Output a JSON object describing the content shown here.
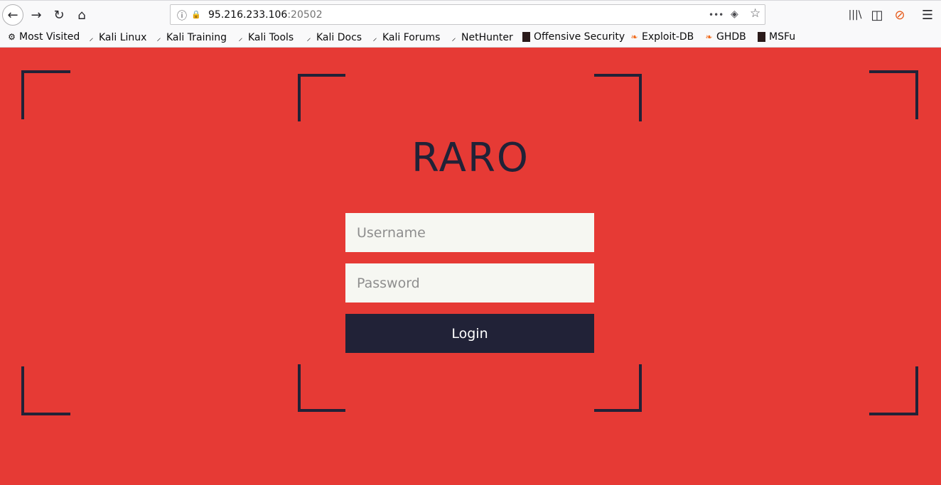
{
  "browser": {
    "url_host": "95.216.233.106",
    "url_port": ":20502",
    "nav": {
      "back_icon": "←",
      "forward_icon": "→",
      "reload_icon": "↻",
      "home_icon": "⌂"
    },
    "url_icons": {
      "info_icon": "ⓘ",
      "insecure_icon": "🔒",
      "more_icon": "•••",
      "pocket_icon": "◈",
      "star_icon": "☆"
    },
    "right_icons": {
      "library_icon": "|||\\",
      "sidebar_icon": "◫",
      "extension_icon": "⊘",
      "menu_icon": "☰"
    },
    "bookmarks": [
      {
        "label": "Most Visited",
        "icon": "gear-icon",
        "glyph": "⚙"
      },
      {
        "label": "Kali Linux",
        "icon": "kali-icon",
        "glyph": "⸝"
      },
      {
        "label": "Kali Training",
        "icon": "kali-icon",
        "glyph": "⸝"
      },
      {
        "label": "Kali Tools",
        "icon": "kali-icon",
        "glyph": "⸝"
      },
      {
        "label": "Kali Docs",
        "icon": "kali-icon",
        "glyph": "⸝"
      },
      {
        "label": "Kali Forums",
        "icon": "kali-icon",
        "glyph": "⸝"
      },
      {
        "label": "NetHunter",
        "icon": "kali-icon",
        "glyph": "⸝"
      },
      {
        "label": "Offensive Security",
        "icon": "offsec-icon",
        "glyph": ""
      },
      {
        "label": "Exploit-DB",
        "icon": "exploitdb-icon",
        "glyph": "❧"
      },
      {
        "label": "GHDB",
        "icon": "exploitdb-icon",
        "glyph": "❧"
      },
      {
        "label": "MSFu",
        "icon": "offsec-icon",
        "glyph": ""
      }
    ]
  },
  "page": {
    "title": "RARO",
    "username_placeholder": "Username",
    "password_placeholder": "Password",
    "login_label": "Login",
    "colors": {
      "background": "#e63a35",
      "dark": "#212237",
      "field": "#f6f7f2"
    }
  }
}
